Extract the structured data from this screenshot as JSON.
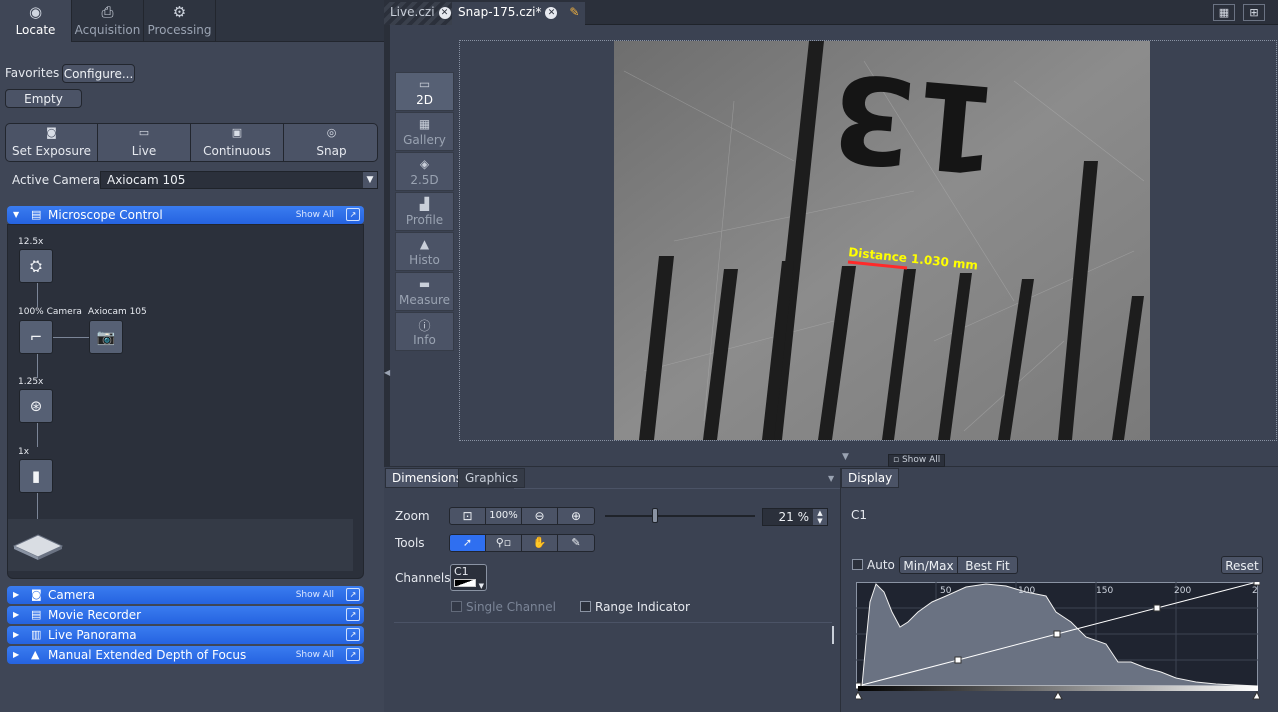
{
  "top_tabs": [
    {
      "label": "Locate",
      "icon": "eye-icon"
    },
    {
      "label": "Acquisition",
      "icon": "camera-acquisition-icon"
    },
    {
      "label": "Processing",
      "icon": "gears-icon"
    }
  ],
  "favorites": {
    "label": "Favorites",
    "configure": "Configure...",
    "empty": "Empty"
  },
  "acq_buttons": [
    {
      "label": "Set Exposure",
      "icon": "exposure-icon"
    },
    {
      "label": "Live",
      "icon": "live-icon"
    },
    {
      "label": "Continuous",
      "icon": "continuous-icon"
    },
    {
      "label": "Snap",
      "icon": "snap-icon"
    }
  ],
  "active_camera": {
    "label": "Active Camera",
    "value": "Axiocam 105"
  },
  "microscope": {
    "title": "Microscope Control",
    "show_all": "Show All",
    "nodes": {
      "objective": "12.5x",
      "camera_port": "100% Camera",
      "camera": "Axiocam 105",
      "optovar": "1.25x",
      "tube": "1x"
    }
  },
  "collapsed_tools": [
    {
      "title": "Camera",
      "show_all": "Show All"
    },
    {
      "title": "Movie Recorder",
      "show_all": ""
    },
    {
      "title": "Live Panorama",
      "show_all": ""
    },
    {
      "title": "Manual Extended Depth of Focus",
      "show_all": "Show All"
    }
  ],
  "doc_tabs": [
    {
      "label": "Live.czi"
    },
    {
      "label": "Snap-175.czi*"
    }
  ],
  "view_tools": [
    {
      "label": "2D",
      "icon": "view-2d-icon"
    },
    {
      "label": "Gallery",
      "icon": "gallery-icon"
    },
    {
      "label": "2.5D",
      "icon": "view-25d-icon"
    },
    {
      "label": "Profile",
      "icon": "profile-icon"
    },
    {
      "label": "Histo",
      "icon": "histogram-icon"
    },
    {
      "label": "Measure",
      "icon": "measure-icon"
    },
    {
      "label": "Info",
      "icon": "info-icon"
    }
  ],
  "image": {
    "annotation": "Distance 1.030 mm",
    "scale_text": "13"
  },
  "bottom": {
    "show_all": "Show All",
    "tabs_left": [
      "Dimensions",
      "Graphics"
    ],
    "tab_right": "Display",
    "zoom_label": "Zoom",
    "zoom_buttons": [
      "fit-icon",
      "100%",
      "zoom-out-icon",
      "zoom-in-icon"
    ],
    "zoom_100": "100%",
    "zoom_value": "21 %",
    "zoom_fraction": 0.21,
    "tools_label": "Tools",
    "channels_label": "Channels",
    "channel": "C1",
    "single_channel": "Single Channel",
    "range_indicator": "Range Indicator"
  },
  "display": {
    "channel": "C1",
    "auto": "Auto",
    "minmax": "Min/Max",
    "bestfit": "Best Fit",
    "reset": "Reset",
    "hist_ticks": [
      "50",
      "100",
      "150",
      "200",
      "2"
    ]
  },
  "colors": {
    "accent": "#2f6ff0",
    "annotation": "#ffff00",
    "measure_line": "#ff2a2a"
  }
}
